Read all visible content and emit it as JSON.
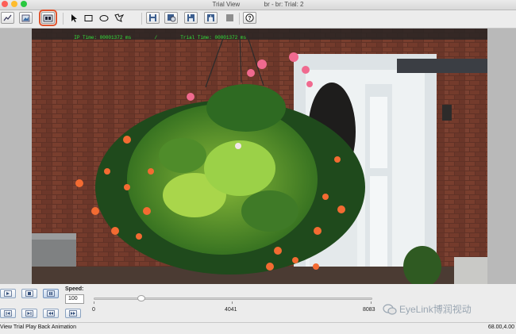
{
  "window": {
    "title": "Trial View",
    "subtitle": "br - br: Trial: 2"
  },
  "toolbar": {
    "buttons": [
      {
        "icon": "line-chart-icon"
      },
      {
        "icon": "image-icon"
      },
      {
        "icon": "playback-animation-icon",
        "selected": true
      },
      {
        "icon": "pointer-icon"
      },
      {
        "icon": "rectangle-icon"
      },
      {
        "icon": "ellipse-icon"
      },
      {
        "icon": "freehand-shape-icon"
      },
      {
        "icon": "save-icon"
      },
      {
        "icon": "save-image-icon"
      },
      {
        "icon": "save-all-icon"
      },
      {
        "icon": "export-icon"
      },
      {
        "icon": "stop-icon"
      },
      {
        "icon": "help-icon"
      }
    ],
    "accent_color": "#e0552f"
  },
  "stage": {
    "ip_time": "IP Time: 00001372 ms",
    "separator": "/",
    "trial_time": "Trial Time: 00001372 ms",
    "overlay_text_color": "#35e23c"
  },
  "playback": {
    "speed_label": "Speed:",
    "speed_value": "100",
    "slider": {
      "min_label": "0",
      "mid_label": "4041",
      "max_label": "8083",
      "position_fraction": 0.17
    }
  },
  "watermark": "EyeLink博润视动",
  "status": {
    "left": "View Trial Play Back Animation",
    "right": "68.00,4.00"
  }
}
